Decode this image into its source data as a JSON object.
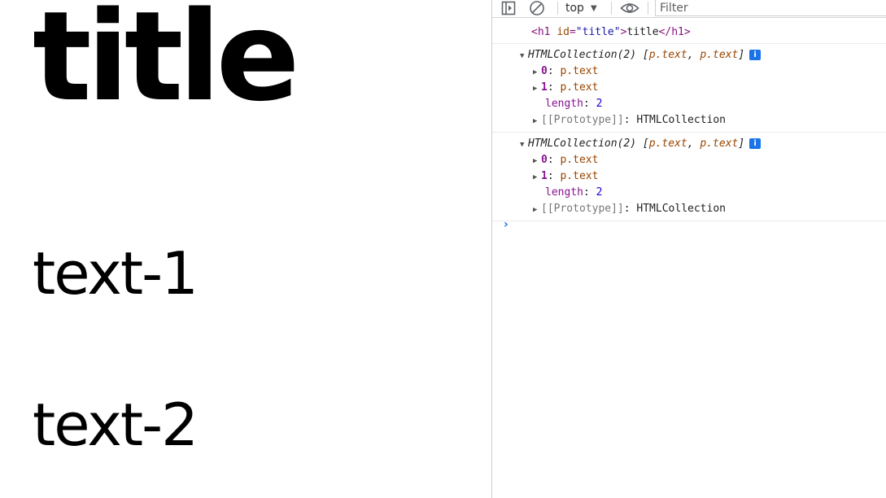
{
  "page": {
    "title": "title",
    "texts": [
      "text-1",
      "text-2"
    ]
  },
  "devtools": {
    "toolbar": {
      "context": "top",
      "filter_placeholder": "Filter"
    },
    "console": {
      "element_log": {
        "tag_open": "<h1",
        "attr_name": "id",
        "attr_value": "\"title\"",
        "text": "title",
        "tag_close": "</h1>"
      },
      "collections": [
        {
          "summary": "HTMLCollection(2)",
          "preview_items": [
            "p.text",
            "p.text"
          ],
          "entries": [
            {
              "key": "0",
              "value": "p.text"
            },
            {
              "key": "1",
              "value": "p.text"
            }
          ],
          "length_key": "length",
          "length_value": "2",
          "prototype_key": "[[Prototype]]",
          "prototype_value": "HTMLCollection"
        },
        {
          "summary": "HTMLCollection(2)",
          "preview_items": [
            "p.text",
            "p.text"
          ],
          "entries": [
            {
              "key": "0",
              "value": "p.text"
            },
            {
              "key": "1",
              "value": "p.text"
            }
          ],
          "length_key": "length",
          "length_value": "2",
          "prototype_key": "[[Prototype]]",
          "prototype_value": "HTMLCollection"
        }
      ],
      "info_badge": "i",
      "prompt": "›"
    }
  },
  "colors": {
    "accent": "#1a73e8",
    "tag": "#881280",
    "attr": "#994500",
    "string": "#1a1aa6"
  }
}
